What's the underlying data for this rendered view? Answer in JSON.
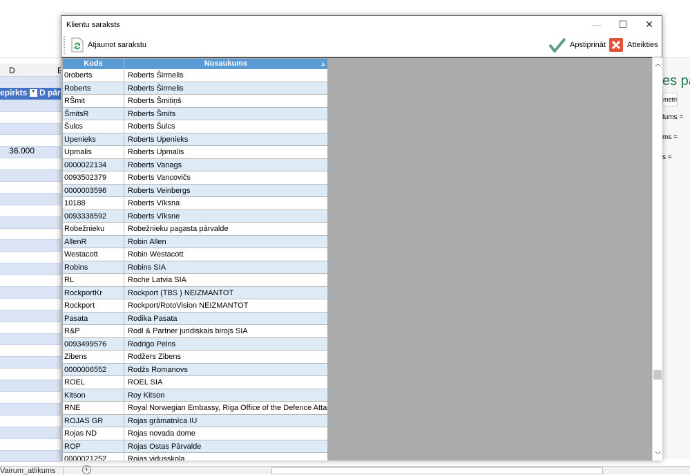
{
  "background": {
    "column_header": "D",
    "column_header_next": "E",
    "table_header": "epirkts",
    "table_header_next": "D pārd",
    "cell_value": "36.000",
    "panel_title": "es par",
    "panel_tab": "metri",
    "panel_labels": [
      "tums  =",
      "ms  =",
      "s  ="
    ],
    "sheet_tab": "Vairum_atlikums",
    "add_sheet": "+"
  },
  "dialog": {
    "title": "Klientu saraksts",
    "window_controls": {
      "minimize": "—",
      "maximize": "☐",
      "close": "✕"
    },
    "toolbar": {
      "refresh_label": "Atjaunot sarakstu",
      "confirm_label": "Apstiprināt",
      "cancel_label": "Atteikties"
    },
    "colors": {
      "header": "#5b9bd5",
      "alt_row": "#ddebf7",
      "confirm": "#5f9e8a",
      "cancel": "#e0533a"
    },
    "table": {
      "columns": [
        "Kods",
        "Nosaukums"
      ],
      "sort_indicator": "▵",
      "rows": [
        [
          "0roberts",
          "Roberts Širmelis"
        ],
        [
          "Roberts",
          "Roberts Širmelis"
        ],
        [
          "RŠmit",
          "Roberts Šmitiņš"
        ],
        [
          "ŠmitsR",
          "Roberts Šmits"
        ],
        [
          "Šulcs",
          "Roberts Šulcs"
        ],
        [
          "Upenieks",
          "Roberts Upenieks"
        ],
        [
          "Upmalis",
          "Roberts Upmalis"
        ],
        [
          "0000022134",
          "Roberts Vanags"
        ],
        [
          "0093502379",
          "Roberts Vancovičs"
        ],
        [
          "0000003596",
          "Roberts Veinbergs"
        ],
        [
          "10188",
          "Roberts Vīksna"
        ],
        [
          "0093338592",
          "Roberts Vīksne"
        ],
        [
          "Robežnieku",
          "Robežnieku pagasta pārvalde"
        ],
        [
          "AllenR",
          "Robin Allen"
        ],
        [
          "Westacott",
          "Robin Westacott"
        ],
        [
          "Robins",
          "Robins SIA"
        ],
        [
          "RL",
          "Roche Latvia SIA"
        ],
        [
          "RockportKr",
          "Rockport (TBS ) NEIZMANTOT"
        ],
        [
          "Rockport",
          "Rockport/RotoVision NEIZMANTOT"
        ],
        [
          "Pasata",
          "Rodika Pasata"
        ],
        [
          "R&P",
          "Rodl & Partner juridiskais birojs SIA"
        ],
        [
          "0093499576",
          "Rodrigo Pelns"
        ],
        [
          "Zibens",
          "Rodžers Zibens"
        ],
        [
          "0000006552",
          "Rodžs Romanovs"
        ],
        [
          "ROEL",
          "ROEL SIA"
        ],
        [
          "Kitson",
          "Roy Kitson"
        ],
        [
          "RNE",
          "Royal Norwegian Embassy, Riga Office of the Defence Attache"
        ],
        [
          "ROJAS GR",
          "Rojas grāmatnīca IU"
        ],
        [
          "Rojas ND",
          "Rojas novada dome"
        ],
        [
          "ROP",
          "Rojas Ostas Pārvalde"
        ],
        [
          "0000021252",
          "Rojas vidusskola"
        ]
      ]
    }
  }
}
